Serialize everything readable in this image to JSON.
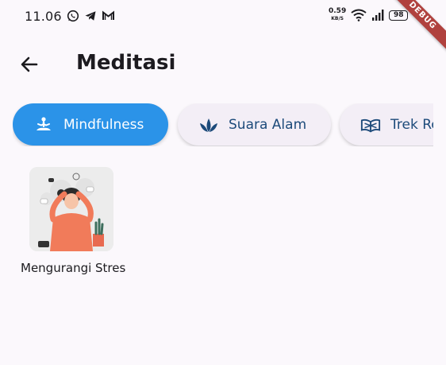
{
  "status_bar": {
    "time": "11.06",
    "app_icons": [
      "whatsapp-icon",
      "telegram-icon",
      "gmail-icon"
    ],
    "net_speed": "0.59",
    "net_unit": "KB/S",
    "battery": "98",
    "debug_label": "DEBUG"
  },
  "app_bar": {
    "title": "Meditasi",
    "back_icon": "arrow-left-icon"
  },
  "categories": [
    {
      "label": "Mindfulness",
      "icon": "meditation-icon",
      "active": true
    },
    {
      "label": "Suara Alam",
      "icon": "leaf-icon",
      "active": false
    },
    {
      "label": "Trek Re",
      "icon": "book-icon",
      "active": false
    }
  ],
  "items": [
    {
      "label": "Mengurangi Stres",
      "image": "stressed-person-illustration"
    }
  ],
  "colors": {
    "accent": "#2b93e8",
    "chip_inactive": "#f3eef6",
    "chip_text": "#1c4a7a",
    "background": "#fbf8fc"
  }
}
